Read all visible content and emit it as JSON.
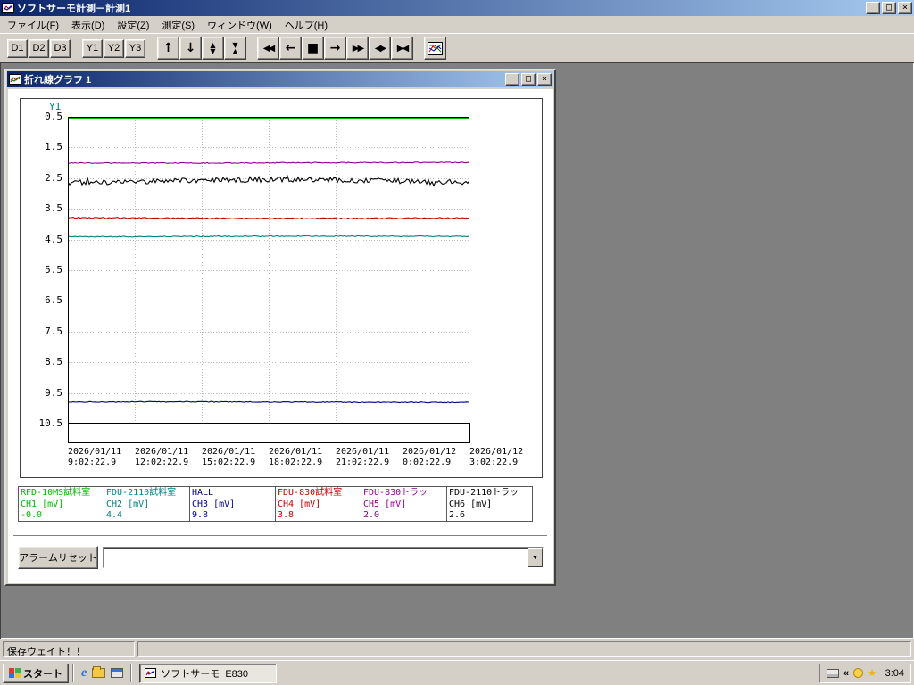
{
  "app": {
    "title": "ソフトサーモ計測－計測1",
    "menu_items": [
      "ファイル(F)",
      "表示(D)",
      "設定(Z)",
      "測定(S)",
      "ウィンドウ(W)",
      "ヘルプ(H)"
    ],
    "toolbar": {
      "display_buttons": [
        "D1",
        "D2",
        "D3"
      ],
      "axis_buttons": [
        "Y1",
        "Y2",
        "Y3"
      ],
      "icon_buttons": [
        {
          "name": "pan-up-button",
          "glyph": "↑"
        },
        {
          "name": "pan-down-button",
          "glyph": "↓"
        },
        {
          "name": "y-range-expand-button",
          "glyph": "▲▼",
          "stack": true
        },
        {
          "name": "y-range-compress-button",
          "glyph": "▼▲",
          "stack": true
        },
        {
          "name": "fast-rewind-button",
          "glyph": "◀◀",
          "small": true
        },
        {
          "name": "step-back-button",
          "glyph": "←"
        },
        {
          "name": "stop-button",
          "glyph": "■"
        },
        {
          "name": "step-forward-button",
          "glyph": "→"
        },
        {
          "name": "fast-forward-button",
          "glyph": "▶▶",
          "small": true
        },
        {
          "name": "x-range-expand-button",
          "glyph": "◀▶",
          "small": true
        },
        {
          "name": "x-range-compress-button",
          "glyph": "▶◀",
          "small": true
        }
      ]
    }
  },
  "icons": {
    "minimize": "_",
    "maximize": "□",
    "close": "×",
    "dropdown": "▼",
    "tray_chevron": "«",
    "tray_star": "★"
  },
  "graph_window": {
    "title": "折れ線グラフ 1",
    "alarm_reset_label": "アラームリセット",
    "combo_value": ""
  },
  "chart_data": {
    "type": "line",
    "y_axis_label": "Y1",
    "y_min": 0.5,
    "y_max": 10.5,
    "y_axis_inverted_downward": true,
    "grid": true,
    "y_ticks": [
      0.5,
      1.5,
      2.5,
      3.5,
      4.5,
      5.5,
      6.5,
      7.5,
      8.5,
      9.5,
      10.5
    ],
    "x_ticks": [
      {
        "date": "2026/01/11",
        "time": "9:02:22.9"
      },
      {
        "date": "2026/01/11",
        "time": "12:02:22.9"
      },
      {
        "date": "2026/01/11",
        "time": "15:02:22.9"
      },
      {
        "date": "2026/01/11",
        "time": "18:02:22.9"
      },
      {
        "date": "2026/01/11",
        "time": "21:02:22.9"
      },
      {
        "date": "2026/01/12",
        "time": "0:02:22.9"
      },
      {
        "date": "2026/01/12",
        "time": "3:02:22.9"
      }
    ],
    "series": [
      {
        "name": "RFD-10MS試料室",
        "channel": "CH1 [mV]",
        "value": "-0.0",
        "color": "#00b800",
        "noise": 0
      },
      {
        "name": "FDU-2110試料室",
        "channel": "CH2 [mV]",
        "value": "4.4",
        "color": "#008080",
        "noise": 0.5
      },
      {
        "name": "HALL",
        "channel": "CH3 [mV]",
        "value": "9.8",
        "color": "#000080",
        "noise": 0.5
      },
      {
        "name": "FDU-830試料室",
        "channel": "CH4 [mV]",
        "value": "3.8",
        "color": "#c00000",
        "noise": 0.6
      },
      {
        "name": "FDU-830トラッ",
        "channel": "CH5 [mV]",
        "value": "2.0",
        "color": "#900090",
        "noise": 0.5
      },
      {
        "name": "FDU-2110トラッ",
        "channel": "CH6 [mV]",
        "value": "2.6",
        "color": "#000000",
        "noise": 2.8
      }
    ],
    "legend_position": "bottom"
  },
  "status_bar": {
    "text": "保存ウェイト！！"
  },
  "taskbar": {
    "start_label": "スタート",
    "task_button_label": "ソフトサーモ  E830",
    "clock": "3:04"
  }
}
